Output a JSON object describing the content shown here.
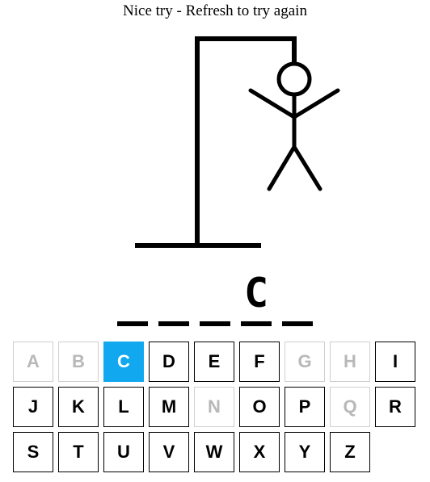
{
  "status_message": "Nice try - Refresh to try again",
  "word": {
    "slots": [
      "",
      "",
      "",
      "C",
      ""
    ]
  },
  "keyboard": {
    "keys": [
      {
        "letter": "A",
        "state": "used"
      },
      {
        "letter": "B",
        "state": "used"
      },
      {
        "letter": "C",
        "state": "active"
      },
      {
        "letter": "D",
        "state": "available"
      },
      {
        "letter": "E",
        "state": "available"
      },
      {
        "letter": "F",
        "state": "available"
      },
      {
        "letter": "G",
        "state": "used"
      },
      {
        "letter": "H",
        "state": "used"
      },
      {
        "letter": "I",
        "state": "available"
      },
      {
        "letter": "J",
        "state": "available"
      },
      {
        "letter": "K",
        "state": "available"
      },
      {
        "letter": "L",
        "state": "available"
      },
      {
        "letter": "M",
        "state": "available"
      },
      {
        "letter": "N",
        "state": "used"
      },
      {
        "letter": "O",
        "state": "available"
      },
      {
        "letter": "P",
        "state": "available"
      },
      {
        "letter": "Q",
        "state": "used"
      },
      {
        "letter": "R",
        "state": "available"
      },
      {
        "letter": "S",
        "state": "available"
      },
      {
        "letter": "T",
        "state": "available"
      },
      {
        "letter": "U",
        "state": "available"
      },
      {
        "letter": "V",
        "state": "available"
      },
      {
        "letter": "W",
        "state": "available"
      },
      {
        "letter": "X",
        "state": "available"
      },
      {
        "letter": "Y",
        "state": "available"
      },
      {
        "letter": "Z",
        "state": "available"
      }
    ]
  },
  "colors": {
    "active_key": "#11a8ef",
    "used_key_text": "#b8b8b8",
    "ink": "#000000"
  }
}
